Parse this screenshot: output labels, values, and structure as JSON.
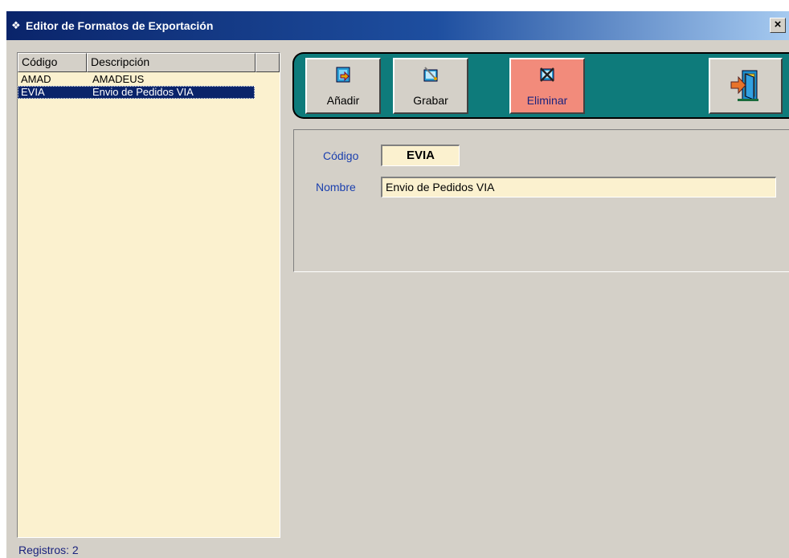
{
  "window": {
    "title": "Editor de Formatos de Exportación",
    "close_label": "×"
  },
  "list": {
    "columns": [
      "Código",
      "Descripción"
    ],
    "rows": [
      {
        "codigo": "AMAD",
        "descripcion": "AMADEUS"
      },
      {
        "codigo": "EVIA",
        "descripcion": "Envio de Pedidos VIA"
      }
    ],
    "selected_index": 1,
    "footer": "Registros: 2"
  },
  "toolbar": {
    "add_label": "Añadir",
    "save_label": "Grabar",
    "delete_label": "Eliminar",
    "exit_icon": "exit-door-icon"
  },
  "form": {
    "codigo_label": "Código",
    "codigo_value": "EVIA",
    "nombre_label": "Nombre",
    "nombre_value": "Envio de Pedidos VIA"
  },
  "colors": {
    "titlebar": "#0a246a",
    "list_background": "#fbf1cf",
    "toolbar_background": "#0e7b7b",
    "delete_button": "#f28b7b",
    "selection": "#0a246a"
  }
}
